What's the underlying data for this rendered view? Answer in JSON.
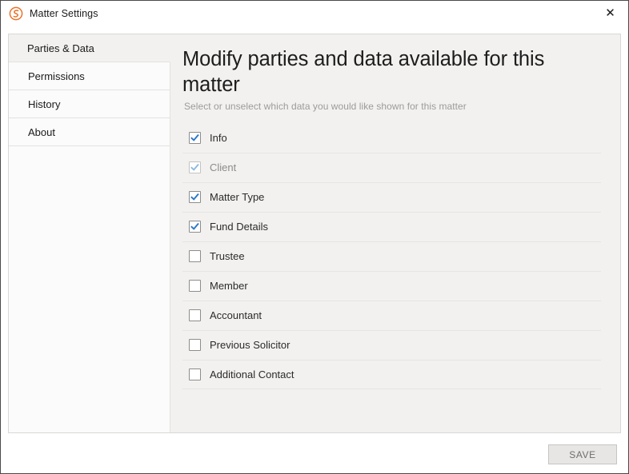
{
  "window": {
    "title": "Matter Settings",
    "app_icon": "app-logo-icon",
    "close_label": "✕"
  },
  "sidebar": {
    "items": [
      {
        "label": "Parties & Data",
        "selected": true
      },
      {
        "label": "Permissions",
        "selected": false
      },
      {
        "label": "History",
        "selected": false
      },
      {
        "label": "About",
        "selected": false
      }
    ]
  },
  "content": {
    "heading": "Modify parties and data available for this matter",
    "subheading": "Select or unselect which data you would like shown for this matter",
    "rows": [
      {
        "label": "Info",
        "checked": true,
        "disabled": false
      },
      {
        "label": "Client",
        "checked": true,
        "disabled": true
      },
      {
        "label": "Matter Type",
        "checked": true,
        "disabled": false
      },
      {
        "label": "Fund Details",
        "checked": true,
        "disabled": false
      },
      {
        "label": "Trustee",
        "checked": false,
        "disabled": false
      },
      {
        "label": "Member",
        "checked": false,
        "disabled": false
      },
      {
        "label": "Accountant",
        "checked": false,
        "disabled": false
      },
      {
        "label": "Previous Solicitor",
        "checked": false,
        "disabled": false
      },
      {
        "label": "Additional Contact",
        "checked": false,
        "disabled": false
      }
    ]
  },
  "footer": {
    "save_label": "SAVE"
  },
  "colors": {
    "accent": "#e8732a",
    "checkmark": "#2b76c8",
    "checkmark_disabled": "#8fb9e0",
    "panel_bg": "#f2f1ef",
    "sidebar_bg": "#fbfbfb",
    "border": "#d8d8d6"
  }
}
